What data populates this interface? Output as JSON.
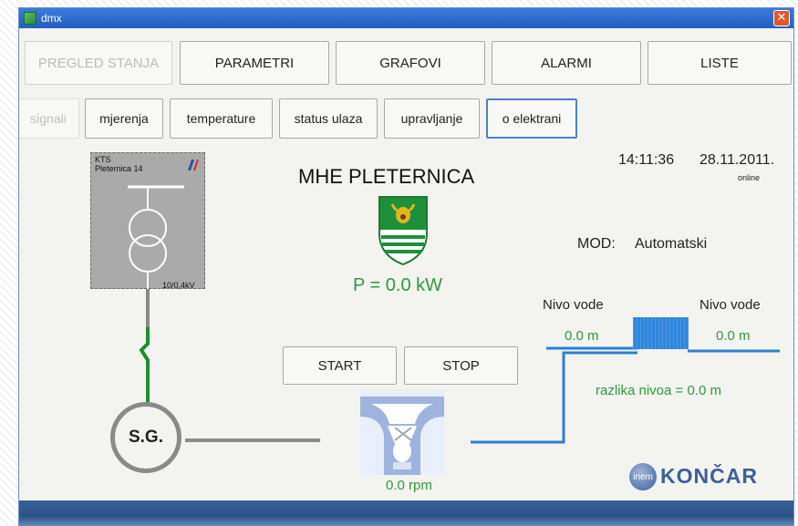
{
  "window": {
    "title": "dmx",
    "close_glyph": "✕"
  },
  "tabs": [
    {
      "label": "PREGLED STANJA",
      "state": "disabled"
    },
    {
      "label": "PARAMETRI"
    },
    {
      "label": "GRAFOVI"
    },
    {
      "label": "ALARMI"
    },
    {
      "label": "LISTE"
    }
  ],
  "subtabs": [
    {
      "label": "signali",
      "state": "disabled"
    },
    {
      "label": "mjerenja"
    },
    {
      "label": "temperature"
    },
    {
      "label": "status ulaza"
    },
    {
      "label": "upravljanje"
    },
    {
      "label": "o elektrani",
      "state": "active"
    }
  ],
  "status": {
    "time": "14:11:36",
    "date": "28.11.2011.",
    "connection": "online"
  },
  "plant": {
    "title": "MHE PLETERNICA",
    "power": "P = 0.0 kW",
    "mode_label": "MOD:",
    "mode_value": "Automatski",
    "speed": "0.0 rpm"
  },
  "kts": {
    "line1": "KTS",
    "line2": "Pleternica 14",
    "voltage": "10/0,4kV"
  },
  "generator": {
    "label": "S.G."
  },
  "controls": {
    "start_label": "START",
    "stop_label": "STOP"
  },
  "water": {
    "left_label": "Nivo vode",
    "left_value": "0.0 m",
    "right_label": "Nivo vode",
    "right_value": "0.0 m",
    "difference": "razlika nivoa = 0.0 m"
  },
  "brand": {
    "badge": "inem",
    "name": "KONČAR"
  },
  "colors": {
    "accent": "#4f7fc8",
    "green": "#2e9a3c",
    "water": "#2f7fd0",
    "titlebar": "#245fc4"
  }
}
